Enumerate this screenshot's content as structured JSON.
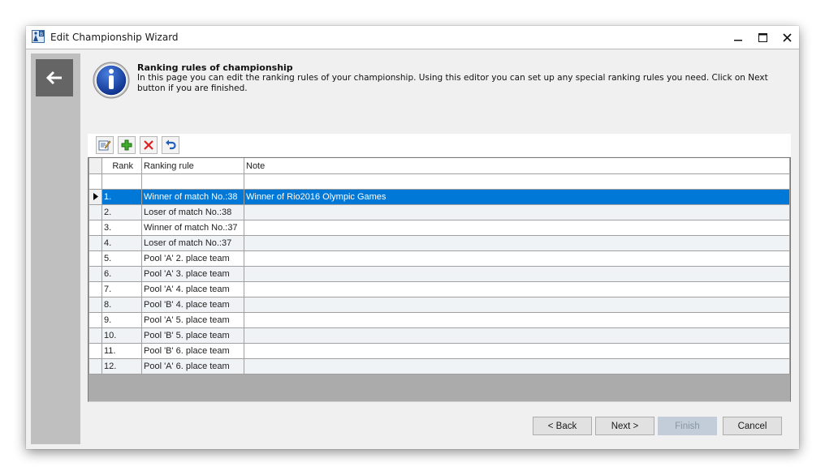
{
  "window": {
    "title": "Edit Championship Wizard",
    "controls": {
      "minimize": "–",
      "maximize": "☐",
      "close": "✕"
    }
  },
  "sidebar": {
    "back_icon": "arrow-left-icon"
  },
  "header": {
    "icon": "info-icon",
    "title": "Ranking rules of championship",
    "description": "In this page you can edit the ranking rules of your championship. Using this editor you can set up any special ranking rules you need. Click on Next button if you are finished."
  },
  "toolbar": {
    "buttons": [
      {
        "name": "edit",
        "icon": "edit-icon"
      },
      {
        "name": "add",
        "icon": "add-icon"
      },
      {
        "name": "delete",
        "icon": "delete-icon"
      },
      {
        "name": "undo",
        "icon": "undo-icon"
      }
    ]
  },
  "grid": {
    "columns": {
      "rank": "Rank",
      "rule": "Ranking rule",
      "note": "Note"
    },
    "selected_row": 0,
    "rows": [
      {
        "rank": "1.",
        "rule": "Winner of match No.:38",
        "note": "Winner of Rio2016 Olympic Games"
      },
      {
        "rank": "2.",
        "rule": "Loser of match No.:38",
        "note": ""
      },
      {
        "rank": "3.",
        "rule": "Winner of match No.:37",
        "note": ""
      },
      {
        "rank": "4.",
        "rule": "Loser of match No.:37",
        "note": ""
      },
      {
        "rank": "5.",
        "rule": "Pool 'A' 2. place team",
        "note": ""
      },
      {
        "rank": "6.",
        "rule": "Pool 'A' 3. place team",
        "note": ""
      },
      {
        "rank": "7.",
        "rule": "Pool 'A' 4. place team",
        "note": ""
      },
      {
        "rank": "8.",
        "rule": "Pool 'B' 4. place team",
        "note": ""
      },
      {
        "rank": "9.",
        "rule": "Pool 'A' 5. place team",
        "note": ""
      },
      {
        "rank": "10.",
        "rule": "Pool 'B' 5. place team",
        "note": ""
      },
      {
        "rank": "11.",
        "rule": "Pool 'B' 6. place team",
        "note": ""
      },
      {
        "rank": "12.",
        "rule": "Pool 'A' 6. place team",
        "note": ""
      }
    ]
  },
  "footer": {
    "back": "< Back",
    "next": "Next >",
    "finish": "Finish",
    "finish_enabled": false,
    "cancel": "Cancel"
  },
  "colors": {
    "selection": "#0078d7",
    "sidebar": "#bfbfbf",
    "back_tile": "#656565"
  }
}
